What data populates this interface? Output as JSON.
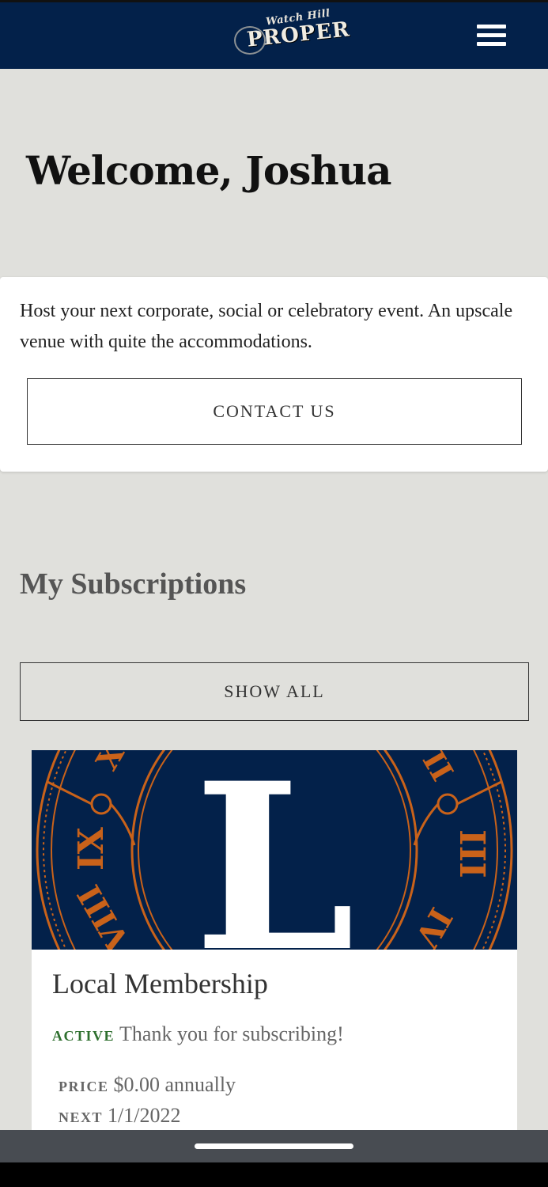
{
  "header": {
    "logo_small": "Watch Hill",
    "logo_big": "PROPER",
    "menu_icon": "hamburger-menu-icon"
  },
  "welcome": "Welcome, Joshua",
  "promo": {
    "text": "Host your next corporate, social or celebratory event.  An upscale venue with quite the accommodations.",
    "button_label": "CONTACT US"
  },
  "subscriptions": {
    "title": "My Subscriptions",
    "show_all_label": "SHOW ALL",
    "items": [
      {
        "name": "Local Membership",
        "status_label": "ACTIVE",
        "status_text": "Thank you for subscribing!",
        "price_label": "PRICE",
        "price_value": "$0.00 annually",
        "next_label": "NEXT",
        "next_value": "1/1/2022",
        "image_letter": "L",
        "image_numerals": [
          "X",
          "IX",
          "VIII",
          "II",
          "III",
          "IV"
        ]
      }
    ]
  },
  "colors": {
    "header_bg": "#03214a",
    "page_bg": "#e0e0dc",
    "accent_orange": "#c9621a",
    "active_green": "#2e6f2e"
  }
}
